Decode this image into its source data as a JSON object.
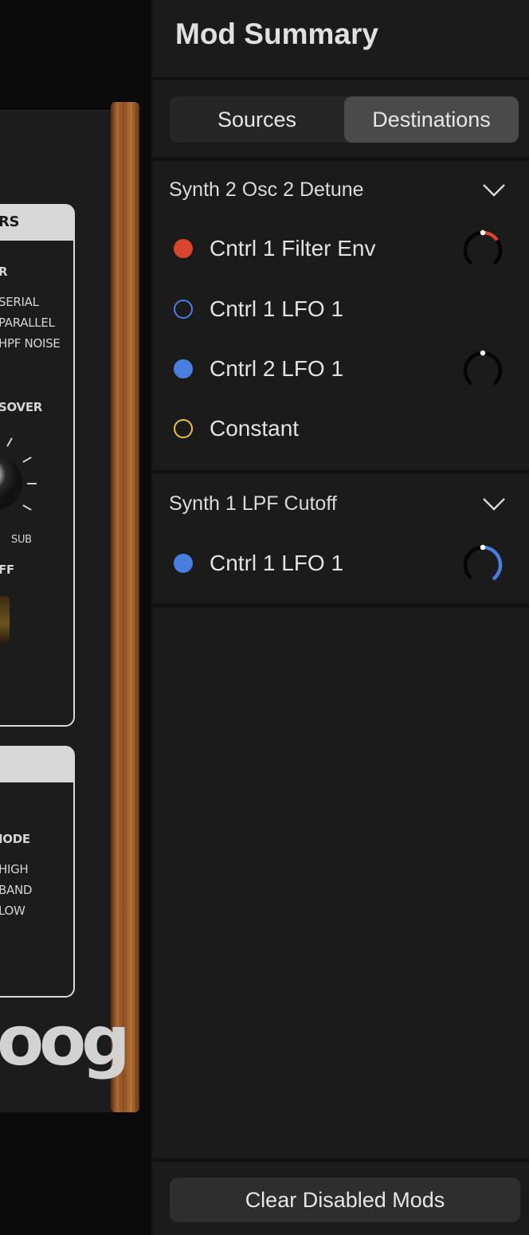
{
  "synth_panel": {
    "section1_header": "RS",
    "section1_labels": [
      "R",
      "SERIAL",
      "PARALLEL",
      "HPF NOISE",
      "SOVER",
      "SUB",
      "FF"
    ],
    "section2_labels": [
      "IODE",
      "HIGH",
      "BAND",
      "LOW"
    ],
    "logo": "oog"
  },
  "mod_summary": {
    "title": "Mod Summary",
    "tabs": [
      {
        "label": "Sources",
        "active": false
      },
      {
        "label": "Destinations",
        "active": true
      }
    ],
    "destinations": [
      {
        "name": "Synth 2 Osc 2 Detune",
        "expanded": true,
        "sources": [
          {
            "label": "Cntrl 1 Filter Env",
            "indicator": "filled",
            "color": "#d7452f",
            "knob": true,
            "amount": 0.14
          },
          {
            "label": "Cntrl 1 LFO 1",
            "indicator": "outline",
            "color": "#4a7fe2",
            "knob": false
          },
          {
            "label": "Cntrl 2 LFO 1",
            "indicator": "filled",
            "color": "#4a7fe2",
            "knob": true,
            "amount": 0.0
          },
          {
            "label": "Constant",
            "indicator": "outline",
            "color": "#e8c53a",
            "knob": false
          }
        ]
      },
      {
        "name": "Synth 1 LPF Cutoff",
        "expanded": true,
        "sources": [
          {
            "label": "Cntrl 1 LFO 1",
            "indicator": "filled",
            "color": "#4a7fe2",
            "knob": true,
            "amount": 0.35
          }
        ]
      }
    ],
    "footer_button": "Clear Disabled Mods"
  }
}
